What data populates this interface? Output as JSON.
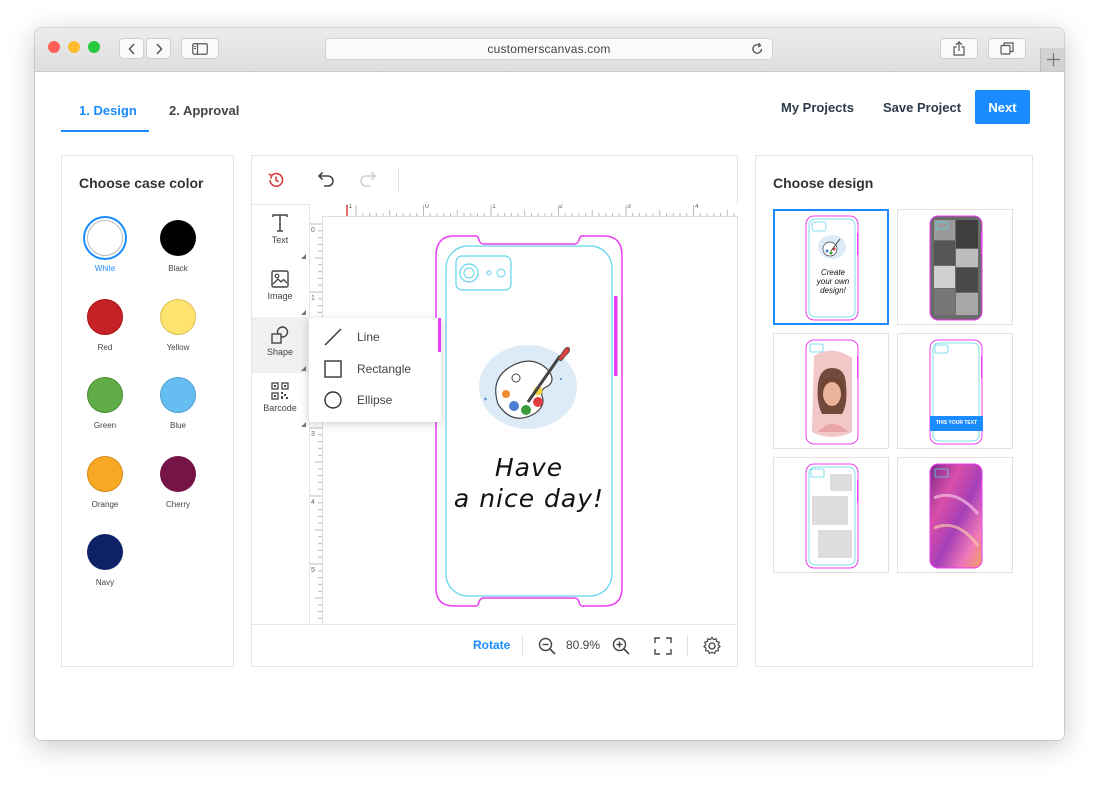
{
  "browser": {
    "url": "customerscanvas.com",
    "traffic_colors": [
      "#fe5f57",
      "#febc2e",
      "#28c840"
    ]
  },
  "steps": [
    {
      "label": "1. Design",
      "active": true
    },
    {
      "label": "2. Approval",
      "active": false
    }
  ],
  "header": {
    "my_projects": "My Projects",
    "save_project": "Save Project",
    "next": "Next"
  },
  "case_color": {
    "title": "Choose case color",
    "selected": "White",
    "colors": [
      {
        "name": "White",
        "hex": "#ffffff"
      },
      {
        "name": "Black",
        "hex": "#000000"
      },
      {
        "name": "Red",
        "hex": "#c62127"
      },
      {
        "name": "Yellow",
        "hex": "#fee46f"
      },
      {
        "name": "Green",
        "hex": "#60ac47"
      },
      {
        "name": "Blue",
        "hex": "#66bdf1"
      },
      {
        "name": "Orange",
        "hex": "#f9a825"
      },
      {
        "name": "Cherry",
        "hex": "#761448"
      },
      {
        "name": "Navy",
        "hex": "#0f2166"
      }
    ]
  },
  "editor": {
    "tools": [
      {
        "label": "Text",
        "icon": "text-icon"
      },
      {
        "label": "Image",
        "icon": "image-icon"
      },
      {
        "label": "Shape",
        "icon": "shape-icon"
      },
      {
        "label": "Barcode",
        "icon": "barcode-icon"
      }
    ],
    "shape_menu": [
      {
        "label": "Line",
        "icon": "line-icon"
      },
      {
        "label": "Rectangle",
        "icon": "rectangle-icon"
      },
      {
        "label": "Ellipse",
        "icon": "ellipse-icon"
      }
    ],
    "ruler_h_labels": [
      "-1",
      "0",
      "1",
      "2",
      "3",
      "4"
    ],
    "ruler_v_labels": [
      "0",
      "1",
      "2",
      "3",
      "4",
      "5"
    ],
    "canvas_text_line1": "Have",
    "canvas_text_line2": "a nice day!",
    "rotate": "Rotate",
    "zoom": "80.9%"
  },
  "designs": {
    "title": "Choose design",
    "thumb1_text": [
      "Create",
      "your own",
      "design!"
    ],
    "thumb4_text": "THIS YOUR TEXT"
  },
  "colors": {
    "accent": "#1a8cff",
    "phone_outline": "#e83df0",
    "phone_inner": "#5fd4ec"
  }
}
